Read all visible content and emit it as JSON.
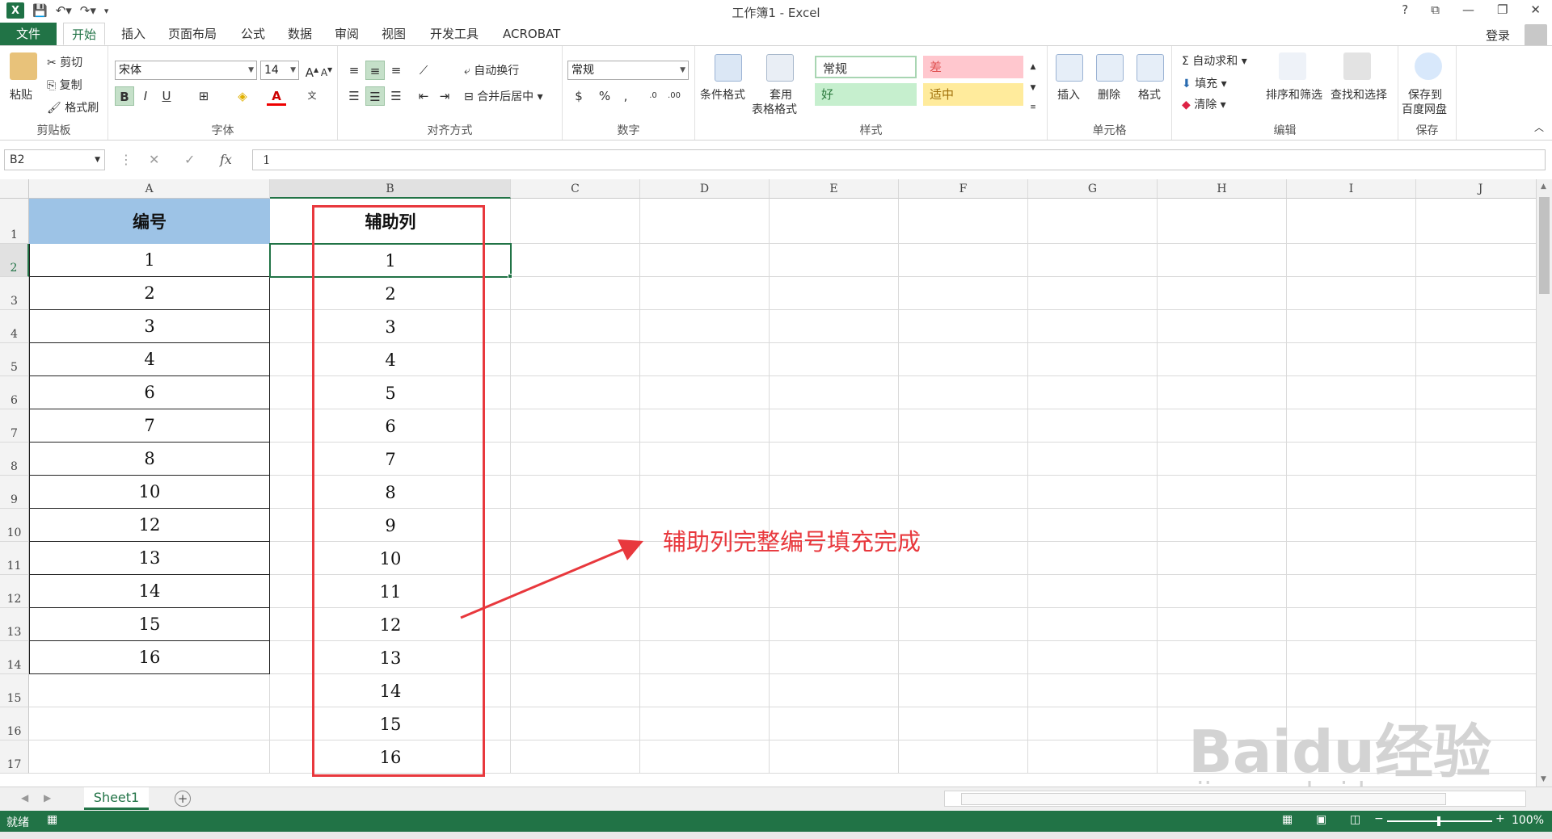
{
  "window": {
    "title": "工作簿1 - Excel",
    "app_logo": "X",
    "controls": [
      "?",
      "⧉",
      "—",
      "❐",
      "✕"
    ]
  },
  "ribbon_tabs": [
    {
      "label": "文件"
    },
    {
      "label": "开始"
    },
    {
      "label": "插入"
    },
    {
      "label": "页面布局"
    },
    {
      "label": "公式"
    },
    {
      "label": "数据"
    },
    {
      "label": "审阅"
    },
    {
      "label": "视图"
    },
    {
      "label": "开发工具"
    },
    {
      "label": "ACROBAT"
    }
  ],
  "account": {
    "login_label": "登录"
  },
  "ribbon": {
    "clipboard": {
      "paste": "粘贴",
      "cut": "剪切",
      "copy": "复制",
      "format_painter": "格式刷",
      "label": "剪贴板"
    },
    "font": {
      "name": "宋体",
      "size": "14",
      "bold": "B",
      "italic": "I",
      "underline": "U",
      "label": "字体"
    },
    "alignment": {
      "wrap": "自动换行",
      "merge": "合并后居中",
      "label": "对齐方式"
    },
    "number": {
      "format": "常规",
      "percent": "%",
      "comma": ",",
      "label": "数字"
    },
    "styles": {
      "conditional": "条件格式",
      "table_format_1": "套用",
      "table_format_2": "表格格式",
      "normal": "常规",
      "bad": "差",
      "good": "好",
      "neutral": "适中",
      "label": "样式"
    },
    "cells": {
      "insert": "插入",
      "delete": "删除",
      "format": "格式",
      "label": "单元格"
    },
    "editing": {
      "autosum": "自动求和",
      "fill": "填充",
      "clear": "清除",
      "sort": "排序和筛选",
      "find": "查找和选择",
      "label": "编辑"
    },
    "save": {
      "line1": "保存到",
      "line2": "百度网盘",
      "label": "保存"
    }
  },
  "formula_bar": {
    "name_box": "B2",
    "fx": "fx",
    "value": "1"
  },
  "columns": [
    "A",
    "B",
    "C",
    "D",
    "E",
    "F",
    "G",
    "H",
    "I",
    "J"
  ],
  "rows": [
    "1",
    "2",
    "3",
    "4",
    "5",
    "6",
    "7",
    "8",
    "9",
    "10",
    "11",
    "12",
    "13",
    "14",
    "15",
    "16",
    "17"
  ],
  "table": {
    "header_a": "编号",
    "header_b": "辅助列",
    "col_a": [
      "1",
      "2",
      "3",
      "4",
      "6",
      "7",
      "8",
      "10",
      "12",
      "13",
      "14",
      "15",
      "16"
    ],
    "col_b": [
      "1",
      "2",
      "3",
      "4",
      "5",
      "6",
      "7",
      "8",
      "9",
      "10",
      "11",
      "12",
      "13",
      "14",
      "15",
      "16"
    ]
  },
  "annotation": {
    "text": "辅助列完整编号填充完成",
    "color": "#e8383d"
  },
  "sheet_tabs": [
    {
      "label": "Sheet1"
    }
  ],
  "status_bar": {
    "ready": "就绪",
    "zoom": "100%"
  },
  "watermark": {
    "brand": "Baidu经验",
    "url": "jingyan.baidu.com"
  },
  "colors": {
    "accent": "#217346",
    "header_fill": "#9dc3e6",
    "good_fill": "#c6efce",
    "bad_fill": "#ffc7ce",
    "neutral_fill": "#ffeb9c"
  }
}
